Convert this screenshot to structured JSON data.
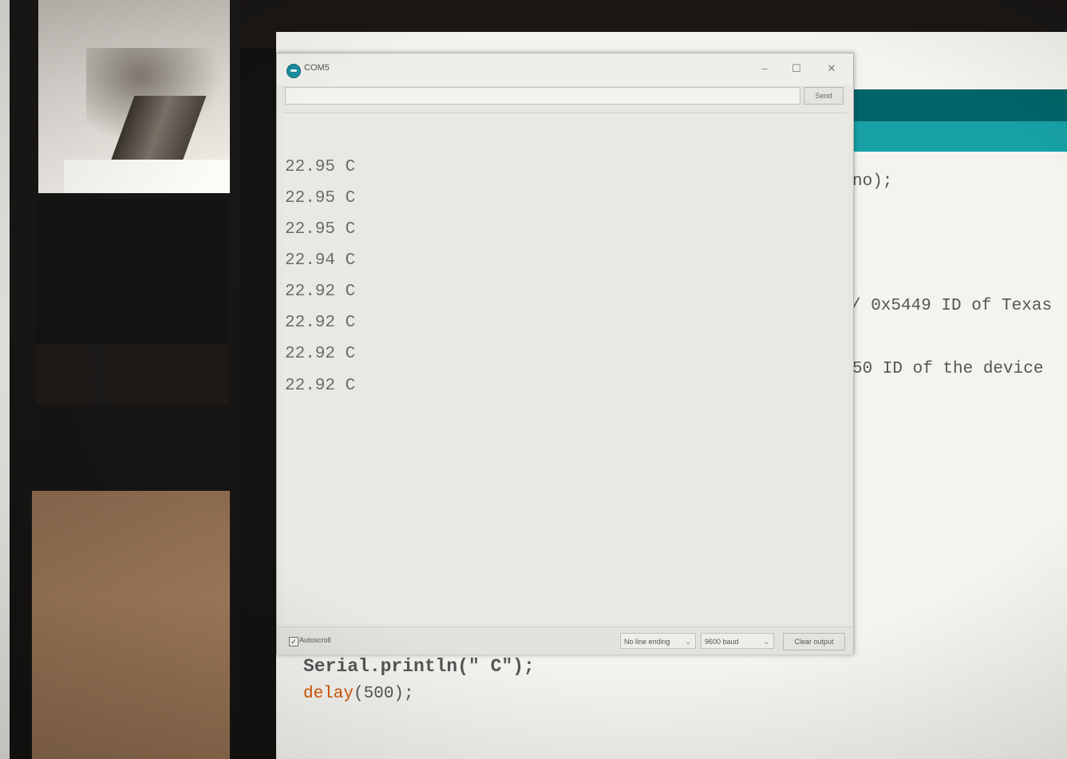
{
  "serial_monitor": {
    "title": "COM5",
    "minimize_glyph": "–",
    "maximize_glyph": "☐",
    "close_glyph": "✕",
    "send_input_value": "",
    "send_label": "Send",
    "output_lines": [
      "22.95 C",
      "22.95 C",
      "22.95 C",
      "22.94 C",
      "22.92 C",
      "22.92 C",
      "22.92 C",
      "22.92 C"
    ],
    "autoscroll_checked": true,
    "autoscroll_label": "Autoscroll",
    "line_ending": "No line ending",
    "baud_rate": "9600 baud",
    "clear_label": "Clear output"
  },
  "ide_code": {
    "line_no": "no);",
    "line_texas": "/ 0x5449 ID of Texas",
    "line_device": "50 ID of the device",
    "line_println": "Serial.println(\" C\");",
    "line_delay_kw": "delay",
    "line_delay_arg": "(500);"
  },
  "colors": {
    "ide_toolbar": "#006468",
    "ide_tabs": "#17a1a5",
    "keyword": "#d35400"
  },
  "icons": {
    "app": "arduino-icon",
    "checkbox": "checkbox-checked-icon",
    "caret": "chevron-down-icon"
  }
}
